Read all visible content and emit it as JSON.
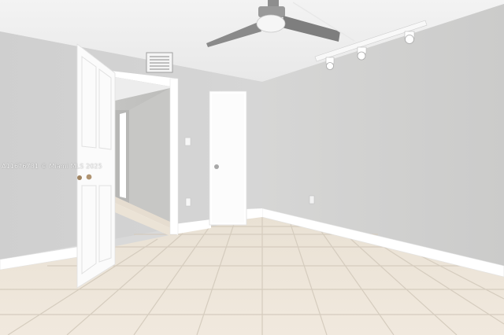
{
  "photo": {
    "watermark": "A11676781 © Miami MLS 2025",
    "colors": {
      "ceiling": "#efefef",
      "left_wall": "#d3d3d3",
      "back_wall": "#d8d8d7",
      "right_wall": "#d2d2d1",
      "floor_tile": "#ede4d7",
      "grout": "#cfc6b8",
      "trim": "#ffffff",
      "fan_metal": "#8a8a8a"
    },
    "objects": [
      "ceiling-fan",
      "track-lighting",
      "air-vent",
      "open-door",
      "doorway-to-hallway",
      "closet-door",
      "light-switch",
      "electrical-outlet",
      "baseboard",
      "tile-floor"
    ]
  }
}
